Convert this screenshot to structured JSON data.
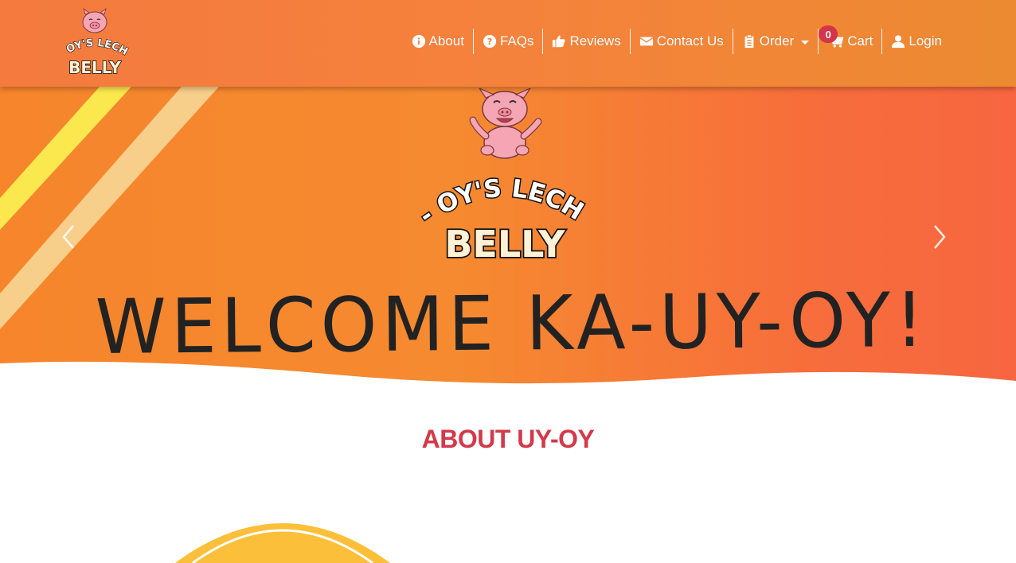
{
  "brand": {
    "logo_line1": "UY- OY'S LECHON",
    "logo_line2": "BELLY"
  },
  "nav": {
    "items": [
      {
        "label": "About",
        "icon": "info-circle-icon"
      },
      {
        "label": "FAQs",
        "icon": "question-circle-icon"
      },
      {
        "label": "Reviews",
        "icon": "thumbs-up-icon"
      },
      {
        "label": "Contact Us",
        "icon": "envelope-icon"
      },
      {
        "label": "Order",
        "icon": "clipboard-list-icon"
      },
      {
        "label": "Cart",
        "icon": "shopping-cart-icon"
      },
      {
        "label": "Login",
        "icon": "user-icon"
      }
    ],
    "cart_count": "0"
  },
  "hero": {
    "logo_line1": "UY- OY'S LECHON",
    "logo_line2": "BELLY",
    "welcome_text": "WELCOME KA-UY-OY!"
  },
  "about": {
    "title": "ABOUT UY-OY"
  },
  "colors": {
    "navbar": "#f5823c",
    "hero_orange": "#f6852c",
    "hero_red_orange": "#f76640",
    "stripe_yellow": "#fbe84f",
    "stripe_peach": "#f8cf8a",
    "about_title": "#d23a4a",
    "badge": "#d63448"
  }
}
